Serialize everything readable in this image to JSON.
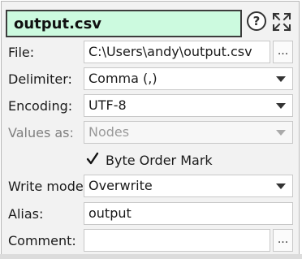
{
  "header": {
    "title": "output.csv",
    "help_icon": "question-circle-icon",
    "expand_icon": "expand-arrows-icon"
  },
  "fields": {
    "file": {
      "label": "File:",
      "value": "C:\\Users\\andy\\output.csv",
      "browse": "..."
    },
    "delimiter": {
      "label": "Delimiter:",
      "value": "Comma (,)"
    },
    "encoding": {
      "label": "Encoding:",
      "value": "UTF-8"
    },
    "values_as": {
      "label": "Values as:",
      "value": "Nodes",
      "disabled": true
    },
    "byte_order_mark": {
      "label": "Byte Order Mark",
      "checked": true
    },
    "write_mode": {
      "label": "Write mode:",
      "value": "Overwrite"
    },
    "alias": {
      "label": "Alias:",
      "value": "output"
    },
    "comment": {
      "label": "Comment:",
      "value": "",
      "browse": "..."
    }
  },
  "colors": {
    "title_background": "#ccfadf",
    "panel_background": "#f2f2f2"
  }
}
